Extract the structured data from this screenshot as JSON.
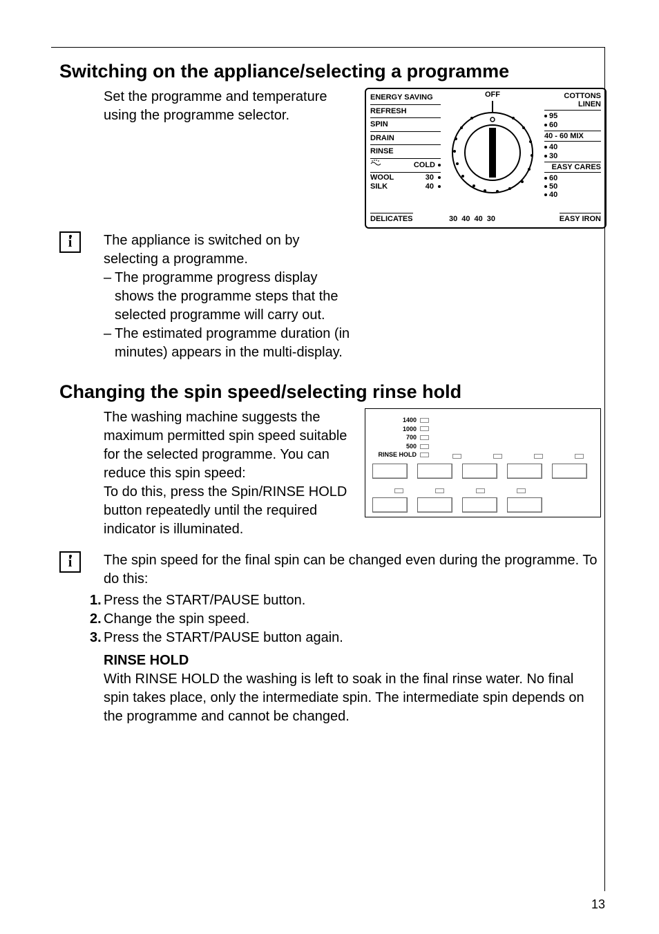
{
  "page_number": "13",
  "section1": {
    "heading": "Switching on the appliance/selecting a programme",
    "para1": "Set the programme and temperature using the programme selector.",
    "para2": "The appliance is switched on by selecting a programme.",
    "bullets": [
      "The programme progress display shows the programme steps that the selected programme will carry out.",
      "The estimated programme duration (in minutes) appears in the multi-display."
    ]
  },
  "section2": {
    "heading": "Changing the spin speed/selecting rinse hold",
    "para1": "The washing machine suggests the maximum permitted spin speed suitable for the selected programme. You can reduce this spin speed:",
    "para2": "To do this, press the Spin/RINSE HOLD button repeatedly until the required indicator is illuminated.",
    "info_para": "The spin speed for the final spin can be changed even during the programme. To do this:",
    "steps": [
      "Press the START/PAUSE button.",
      "Change the spin speed.",
      "Press the START/PAUSE button again."
    ],
    "rinse_hold_title": "RINSE HOLD",
    "rinse_hold_body": "With RINSE HOLD the washing is left to soak in the final rinse water. No final spin takes place, only the intermediate spin. The intermediate spin depends on the programme and cannot be changed."
  },
  "dial": {
    "left_labels": [
      "ENERGY SAVING",
      "REFRESH",
      "SPIN",
      "DRAIN",
      "RINSE"
    ],
    "cold_label": "COLD",
    "wool_label": "WOOL",
    "silk_label": "SILK",
    "delicates_label": "DELICATES",
    "easy_iron_label": "EASY IRON",
    "off_label": "OFF",
    "right_labels": [
      "COTTONS LINEN",
      "40 - 60 MIX"
    ],
    "right_temps_upper": [
      "95",
      "60"
    ],
    "right_temps_mid": [
      "40",
      "30"
    ],
    "easy_cares_label": "EASY CARES",
    "easy_cares_temps": [
      "60",
      "50",
      "40"
    ],
    "bottom_temps_right": [
      "30",
      "40",
      "40"
    ],
    "bottom_temps_left": [
      "40",
      "30",
      "30"
    ]
  },
  "spin_panel": {
    "speeds": [
      "1400",
      "1000",
      "700",
      "500"
    ],
    "rinse_hold": "RINSE HOLD"
  }
}
